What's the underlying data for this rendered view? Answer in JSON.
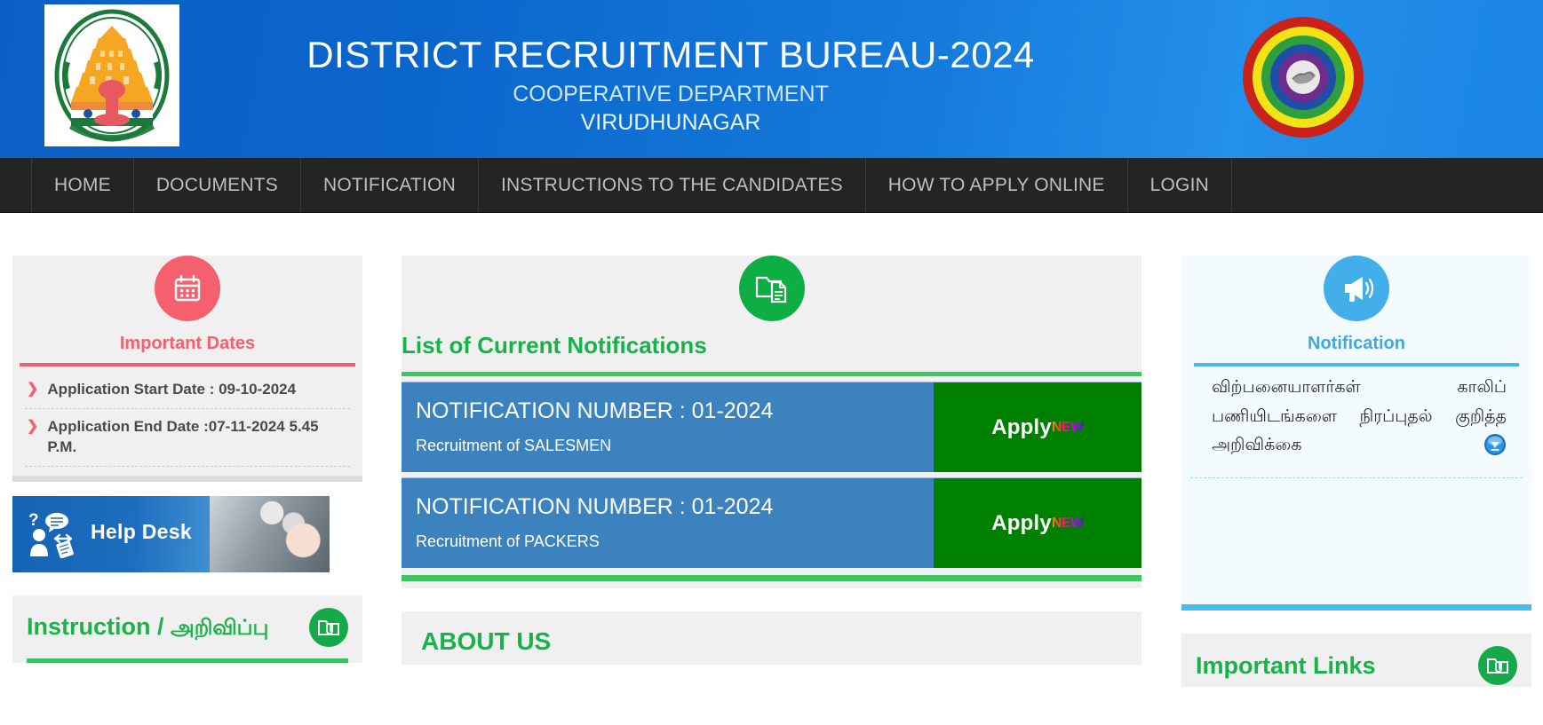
{
  "header": {
    "title": "DISTRICT RECRUITMENT BUREAU-2024",
    "subtitle": "COOPERATIVE DEPARTMENT",
    "district": "VIRUDHUNAGAR",
    "left_logo": "tamil-nadu-state-emblem",
    "right_logo": "cooperative-rainbow-emblem",
    "bg_color": "#0b66cc"
  },
  "nav": {
    "items": [
      {
        "label": "HOME"
      },
      {
        "label": "DOCUMENTS"
      },
      {
        "label": "NOTIFICATION"
      },
      {
        "label": "INSTRUCTIONS TO THE CANDIDATES"
      },
      {
        "label": "HOW TO APPLY ONLINE"
      },
      {
        "label": "LOGIN"
      }
    ]
  },
  "important_dates": {
    "icon": "calendar-icon",
    "title": "Important Dates",
    "accent": "#f4606e",
    "items": [
      {
        "text": "Application Start Date : 09-10-2024"
      },
      {
        "text": "Application End Date :07-11-2024 5.45 P.M."
      }
    ]
  },
  "help_desk": {
    "label": "Help Desk",
    "icon": "help-desk-icon"
  },
  "instruction": {
    "title_en": "Instruction /",
    "title_ta": "அறிவிப்பு",
    "icon": "folder-attachment-icon",
    "accent": "#1ab34a"
  },
  "notifications": {
    "icon": "documents-folder-icon",
    "title": "List of Current Notifications",
    "accent": "#18b24a",
    "rows": [
      {
        "number": "NOTIFICATION NUMBER : 01-2024",
        "description": "Recruitment of SALESMEN",
        "apply_label": "Apply",
        "badge": "NEW"
      },
      {
        "number": "NOTIFICATION NUMBER : 01-2024",
        "description": "Recruitment of PACKERS",
        "apply_label": "Apply",
        "badge": "NEW"
      }
    ]
  },
  "about": {
    "title": "ABOUT US"
  },
  "notification_panel": {
    "icon": "megaphone-icon",
    "title": "Notification",
    "accent": "#3ba8e8",
    "entry": "விற்பனையாளர்கள் காலிப் பணியிடங்களை நிரப்புதல் குறித்த அறிவிக்கை",
    "download_icon": "download-icon"
  },
  "important_links": {
    "title": "Important Links",
    "icon": "folder-attachment-icon"
  }
}
